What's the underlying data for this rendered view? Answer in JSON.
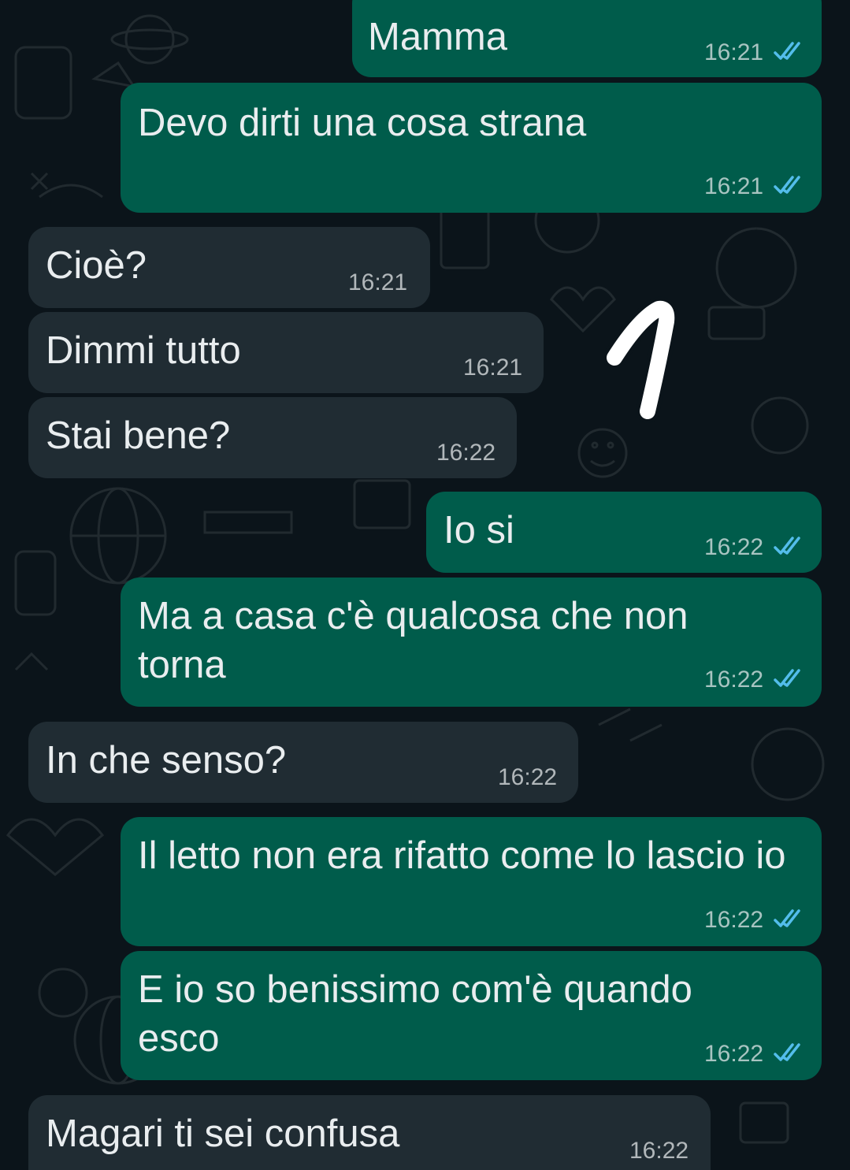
{
  "colors": {
    "background": "#0b141a",
    "outgoing_bubble": "#005c4b",
    "incoming_bubble": "#202c33",
    "text": "#e9edef",
    "read_ticks": "#53bdeb"
  },
  "messages": [
    {
      "direction": "out",
      "text": "Mamma",
      "time": "16:21",
      "status": "read"
    },
    {
      "direction": "out",
      "text": "Devo dirti una cosa strana",
      "time": "16:21",
      "status": "read"
    },
    {
      "direction": "in",
      "text": "Cioè?",
      "time": "16:21"
    },
    {
      "direction": "in",
      "text": "Dimmi tutto",
      "time": "16:21"
    },
    {
      "direction": "in",
      "text": "Stai bene?",
      "time": "16:22"
    },
    {
      "direction": "out",
      "text": "Io si",
      "time": "16:22",
      "status": "read"
    },
    {
      "direction": "out",
      "text": "Ma a casa c'è qualcosa che non torna",
      "time": "16:22",
      "status": "read"
    },
    {
      "direction": "in",
      "text": "In che senso?",
      "time": "16:22"
    },
    {
      "direction": "out",
      "text": "Il letto non era rifatto come lo lascio io",
      "time": "16:22",
      "status": "read"
    },
    {
      "direction": "out",
      "text": "E io so benissimo com'è quando esco",
      "time": "16:22",
      "status": "read"
    },
    {
      "direction": "in",
      "text": "Magari ti sei confusa",
      "time": "16:22"
    }
  ],
  "annotation": {
    "icon": "hand-drawn-number-one",
    "color": "#ffffff"
  }
}
